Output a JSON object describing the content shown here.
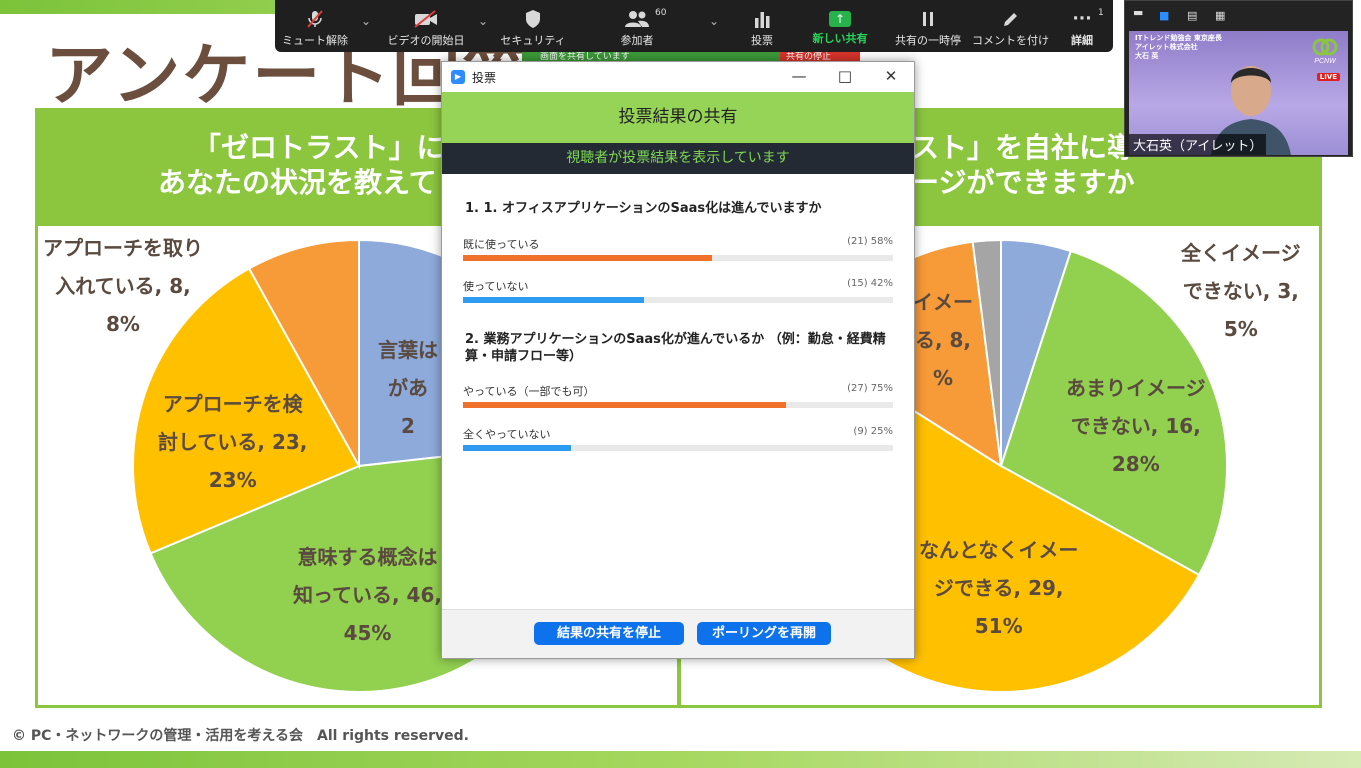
{
  "slide": {
    "title": "アンケート回答",
    "left_panel": {
      "heading_line1": "「ゼロトラスト」に",
      "heading_line2": "あなたの状況を教えて"
    },
    "right_panel": {
      "heading_line1": "スト」を自社に導",
      "heading_line2": "ージができますか"
    },
    "copyright": "© PC・ネットワークの管理・活用を考える会　All rights reserved."
  },
  "chart_data": [
    {
      "type": "pie",
      "slices": [
        {
          "label_lines": [
            "言葉は",
            "があ",
            "2"
          ],
          "value": 23,
          "percent": 23,
          "color": "#8eaadb"
        },
        {
          "label_lines": [
            "意味する概念は",
            "知っている, 46,",
            "45%"
          ],
          "value": 46,
          "percent": 45,
          "color": "#92d050"
        },
        {
          "label_lines": [
            "アプローチを検",
            "討している, 23,",
            "23%"
          ],
          "value": 23,
          "percent": 23,
          "color": "#ffc000"
        },
        {
          "label_lines": [
            "アプローチを取り",
            "入れている, 8,",
            "8%"
          ],
          "value": 8,
          "percent": 8,
          "color": "#f79a38"
        }
      ]
    },
    {
      "type": "pie",
      "slices": [
        {
          "label_lines": [
            "全くイメージ",
            "できない, 3,",
            "5%"
          ],
          "value": 3,
          "percent": 5,
          "color": "#8eaadb"
        },
        {
          "label_lines": [
            "あまりイメージ",
            "できない, 16,",
            "28%"
          ],
          "value": 16,
          "percent": 28,
          "color": "#92d050"
        },
        {
          "label_lines": [
            "なんとなくイメー",
            "ジできる, 29,",
            "51%"
          ],
          "value": 29,
          "percent": 51,
          "color": "#ffc000"
        },
        {
          "label_lines": [
            "イメー",
            "る, 8,",
            "%"
          ],
          "value": 8,
          "percent": 14,
          "color": "#f79a38"
        },
        {
          "label_lines": [],
          "value": 1,
          "percent": 2,
          "color": "#a5a5a5"
        }
      ]
    }
  ],
  "zoom_toolbar": {
    "mute": "ミュート解除",
    "video": "ビデオの開始日",
    "security": "セキュリティ",
    "participants": "参加者",
    "participants_count": "60",
    "poll": "投票",
    "new_share": "新しい共有",
    "pause_share": "共有の一時停",
    "annotate": "コメントを付け",
    "more": "詳細",
    "more_badge": "1"
  },
  "share_strip": {
    "text": "画面を共有しています",
    "stop": "共有の停止"
  },
  "video_panel": {
    "org_line1": "ITトレンド勉強会 東京座長",
    "org_line2": "アイレット株式会社",
    "org_line3": "大石 英",
    "logo_text": "PCNW",
    "live": "LIVE",
    "participant_name": "大石英（アイレット）"
  },
  "poll_dialog": {
    "window_title": "投票",
    "header": "投票結果の共有",
    "subheader": "視聴者が投票結果を表示しています",
    "questions": [
      {
        "title": "1. 1. オフィスアプリケーションのSaas化は進んでいますか",
        "options": [
          {
            "label": "既に使っている",
            "stat": "(21) 58%",
            "percent": 58,
            "color": "#f0722a"
          },
          {
            "label": "使っていない",
            "stat": "(15) 42%",
            "percent": 42,
            "color": "#2d9cf0"
          }
        ]
      },
      {
        "title": "2. 業務アプリケーションのSaas化が進んでいるか （例：勤怠・経費精算・申請フロー等）",
        "options": [
          {
            "label": "やっている（一部でも可）",
            "stat": "(27) 75%",
            "percent": 75,
            "color": "#f0722a"
          },
          {
            "label": "全くやっていない",
            "stat": "(9) 25%",
            "percent": 25,
            "color": "#2d9cf0"
          }
        ]
      }
    ],
    "stop_share_button": "結果の共有を停止",
    "reopen_button": "ポーリングを再開"
  }
}
